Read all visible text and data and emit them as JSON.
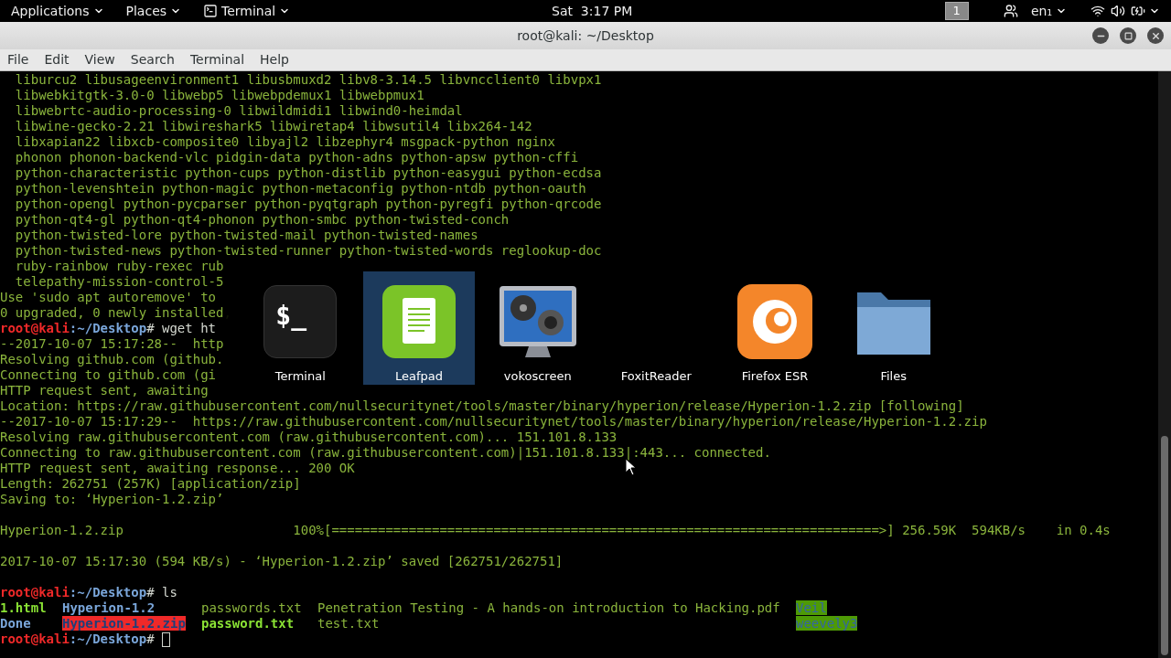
{
  "top_bar": {
    "menus": [
      {
        "label": "Applications",
        "kind": "menu"
      },
      {
        "label": "Places",
        "kind": "menu"
      },
      {
        "label": "Terminal",
        "kind": "app"
      }
    ],
    "clock": "Sat  3:17 PM",
    "workspace": "1",
    "keyboard": "en₁"
  },
  "window": {
    "title": "root@kali: ~/Desktop",
    "menu": [
      "File",
      "Edit",
      "View",
      "Search",
      "Terminal",
      "Help"
    ]
  },
  "terminal": {
    "lines": [
      {
        "kind": "output",
        "text": "  liburcu2 libusageenvironment1 libusbmuxd2 libv8-3.14.5 libvncclient0 libvpx1"
      },
      {
        "kind": "output",
        "text": "  libwebkitgtk-3.0-0 libwebp5 libwebpdemux1 libwebpmux1"
      },
      {
        "kind": "output",
        "text": "  libwebrtc-audio-processing-0 libwildmidi1 libwind0-heimdal"
      },
      {
        "kind": "output",
        "text": "  libwine-gecko-2.21 libwireshark5 libwiretap4 libwsutil4 libx264-142"
      },
      {
        "kind": "output",
        "text": "  libxapian22 libxcb-composite0 libyajl2 libzephyr4 msgpack-python nginx"
      },
      {
        "kind": "output",
        "text": "  phonon phonon-backend-vlc pidgin-data python-adns python-apsw python-cffi"
      },
      {
        "kind": "output",
        "text": "  python-characteristic python-cups python-distlib python-easygui python-ecdsa"
      },
      {
        "kind": "output",
        "text": "  python-levenshtein python-magic python-metaconfig python-ntdb python-oauth"
      },
      {
        "kind": "output",
        "text": "  python-opengl python-pycparser python-pyqtgraph python-pyregfi python-qrcode"
      },
      {
        "kind": "output",
        "text": "  python-qt4-gl python-qt4-phonon python-smbc python-twisted-conch"
      },
      {
        "kind": "output",
        "text": "  python-twisted-lore python-twisted-mail python-twisted-names"
      },
      {
        "kind": "output",
        "text": "  python-twisted-news python-twisted-runner python-twisted-words reglookup-doc"
      },
      {
        "kind": "output",
        "text": "  ruby-rainbow ruby-rexec rub"
      },
      {
        "kind": "output",
        "text": "  telepathy-mission-control-5"
      },
      {
        "kind": "output",
        "text": "Use 'sudo apt autoremove' to"
      },
      {
        "kind": "output",
        "text": "0 upgraded, 0 newly installed,"
      },
      {
        "kind": "prompt",
        "user": "root@kali",
        "path": ":~/Desktop",
        "command": "# wget ht",
        "cursor": false
      },
      {
        "kind": "output",
        "text": "--2017-10-07 15:17:28--  http"
      },
      {
        "kind": "output",
        "text": "Resolving github.com (github."
      },
      {
        "kind": "output",
        "text": "Connecting to github.com (gi"
      },
      {
        "kind": "output",
        "text": "HTTP request sent, awaiting"
      },
      {
        "kind": "output",
        "text": "Location: https://raw.githubusercontent.com/nullsecuritynet/tools/master/binary/hyperion/release/Hyperion-1.2.zip [following]"
      },
      {
        "kind": "output",
        "text": "--2017-10-07 15:17:29--  https://raw.githubusercontent.com/nullsecuritynet/tools/master/binary/hyperion/release/Hyperion-1.2.zip"
      },
      {
        "kind": "output",
        "text": "Resolving raw.githubusercontent.com (raw.githubusercontent.com)... 151.101.8.133"
      },
      {
        "kind": "output",
        "text": "Connecting to raw.githubusercontent.com (raw.githubusercontent.com)|151.101.8.133|:443... connected."
      },
      {
        "kind": "output",
        "text": "HTTP request sent, awaiting response... 200 OK"
      },
      {
        "kind": "output",
        "text": "Length: 262751 (257K) [application/zip]"
      },
      {
        "kind": "output",
        "text": "Saving to: ‘Hyperion-1.2.zip’"
      },
      {
        "kind": "blank"
      },
      {
        "kind": "output",
        "text": "Hyperion-1.2.zip                      100%[=======================================================================>] 256.59K  594KB/s    in 0.4s"
      },
      {
        "kind": "blank"
      },
      {
        "kind": "output",
        "text": "2017-10-07 15:17:30 (594 KB/s) - ‘Hyperion-1.2.zip’ saved [262751/262751]"
      },
      {
        "kind": "blank"
      },
      {
        "kind": "prompt",
        "user": "root@kali",
        "path": ":~/Desktop",
        "command": "# ls",
        "cursor": false
      },
      {
        "kind": "listing",
        "rows": [
          [
            {
              "name": "1.html",
              "kind": "exec"
            },
            {
              "name": "Hyperion-1.2",
              "kind": "dir"
            },
            {
              "name": "passwords.txt",
              "kind": "file"
            },
            {
              "name": "Penetration Testing - A hands-on introduction to Hacking.pdf",
              "kind": "file"
            },
            {
              "name": "Veil",
              "kind": "shared"
            }
          ],
          [
            {
              "name": "Done",
              "kind": "dir"
            },
            {
              "name": "Hyperion-1.2.zip",
              "kind": "archive"
            },
            {
              "name": "password.txt",
              "kind": "exec"
            },
            {
              "name": "test.txt",
              "kind": "file"
            },
            {
              "name": "weevely3",
              "kind": "shared"
            }
          ]
        ]
      },
      {
        "kind": "prompt",
        "user": "root@kali",
        "path": ":~/Desktop",
        "command": "# ",
        "cursor": true
      }
    ]
  },
  "switcher": {
    "apps": [
      {
        "label": "Terminal",
        "kind": "terminal",
        "glyph": "$_",
        "selected": false
      },
      {
        "label": "Leafpad",
        "kind": "leafpad",
        "selected": true
      },
      {
        "label": "vokoscreen",
        "kind": "vokoscreen",
        "selected": false
      },
      {
        "label": "FoxitReader",
        "kind": "blank",
        "selected": false
      },
      {
        "label": "Firefox ESR",
        "kind": "firefox",
        "selected": false
      },
      {
        "label": "Files",
        "kind": "files",
        "selected": false
      }
    ]
  }
}
